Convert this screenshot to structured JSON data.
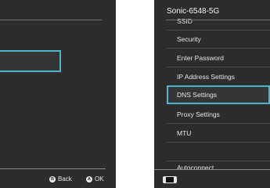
{
  "left_panel": {
    "hints": {
      "back_label": "Back",
      "back_button": "B",
      "ok_label": "OK",
      "ok_button": "A"
    }
  },
  "right_panel": {
    "title": "Sonic-6548-5G",
    "items": [
      {
        "label": "SSID"
      },
      {
        "label": "Security"
      },
      {
        "label": "Enter Password"
      },
      {
        "label": "IP Address Settings"
      },
      {
        "label": "DNS Settings",
        "selected": true
      },
      {
        "label": "Proxy Settings"
      },
      {
        "label": "MTU"
      },
      {
        "label": ""
      },
      {
        "label": "Autoconnect"
      }
    ],
    "footer_icon": "handheld-console-icon"
  },
  "colors": {
    "panel_bg": "#2d2d2d",
    "selection_border": "#4fb3cc",
    "text": "#e3e3e3"
  }
}
